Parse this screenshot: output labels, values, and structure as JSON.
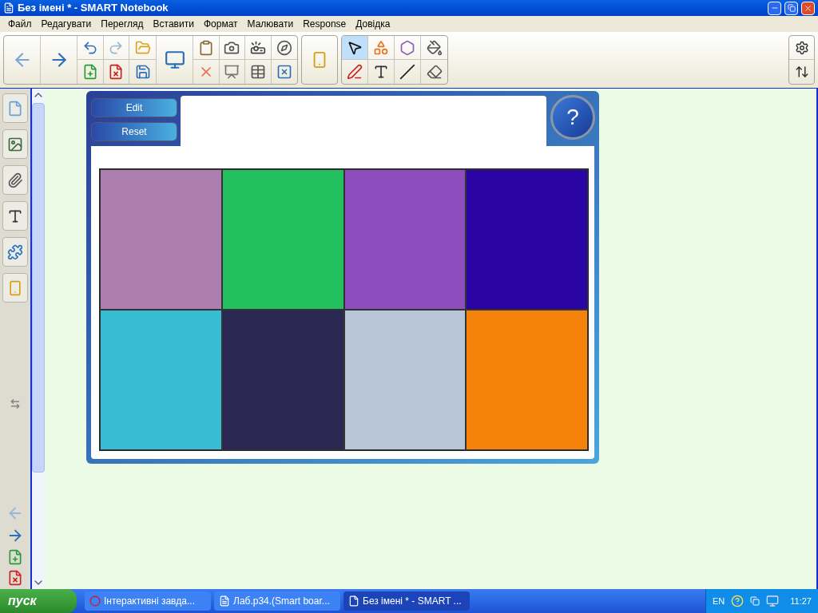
{
  "window": {
    "title": "Без імені * - SMART Notebook"
  },
  "menu": [
    "Файл",
    "Редагувати",
    "Перегляд",
    "Вставити",
    "Формат",
    "Малювати",
    "Response",
    "Довідка"
  ],
  "tools": [
    {
      "selected": true
    },
    {
      "selected": false
    },
    {
      "selected": false
    },
    {
      "selected": false
    },
    {
      "selected": false
    },
    {
      "selected": false
    },
    {
      "selected": false
    },
    {
      "selected": false
    }
  ],
  "widget": {
    "buttons": [
      "Edit",
      "Reset"
    ],
    "help": "?",
    "tiles": [
      {
        "color": "#ad7fb1"
      },
      {
        "color": "#22c05f"
      },
      {
        "color": "#8e4dbd"
      },
      {
        "color": "#2a05a3"
      },
      {
        "color": "#36bdd4"
      },
      {
        "color": "#2b2753"
      },
      {
        "color": "#b8c6d7"
      },
      {
        "color": "#f5820a"
      }
    ]
  },
  "taskbar": {
    "start": "пуск",
    "items": [
      {
        "label": "Інтерактивні завда...",
        "kind": "opera",
        "selected": false
      },
      {
        "label": "Лаб.р34.(Smart boar...",
        "kind": "word",
        "selected": false
      },
      {
        "label": "Без імені * - SMART ...",
        "kind": "notebook",
        "selected": true
      }
    ],
    "language": "EN",
    "clock": "11:27"
  }
}
